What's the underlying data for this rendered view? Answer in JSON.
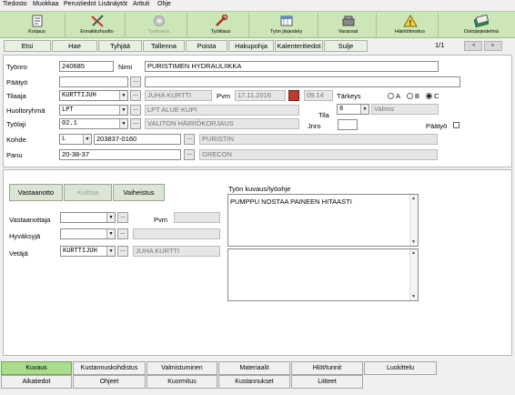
{
  "menubar": [
    "Tiedosto",
    "Muokkaa",
    "Perustiedot",
    "Lisänäytöt",
    "Arttuti",
    "Ohje"
  ],
  "toolbar": [
    {
      "label": "Korjaus",
      "icon": "document-icon",
      "enabled": true
    },
    {
      "label": "Ennakkohuolto",
      "icon": "tools-icon",
      "enabled": true
    },
    {
      "label": "Tyobonus",
      "icon": "gear-icon",
      "enabled": false
    },
    {
      "label": "Työtilaus",
      "icon": "wrench-icon",
      "enabled": true
    },
    {
      "label": "Työn järjestely",
      "icon": "schedule-icon",
      "enabled": true
    },
    {
      "label": "Varaosat",
      "icon": "parts-icon",
      "enabled": true
    },
    {
      "label": "Häiriöilmoitus",
      "icon": "warning-icon",
      "enabled": true
    },
    {
      "label": "Ostojärjestelmä",
      "icon": "purchase-icon",
      "enabled": true
    }
  ],
  "commands": [
    "Etsi",
    "Hae",
    "Tyhjää",
    "Tallenna",
    "Poista",
    "Hakupohja",
    "Kalenteritiedot",
    "Sulje"
  ],
  "pager": "1/1",
  "nav": {
    "prev": "◄",
    "next": "►"
  },
  "form": {
    "tyonro_label": "Työnro",
    "tyonro": "240685",
    "nimi_label": "Nimi",
    "nimi": "PURISTIMEN HYDRAULIIKKA",
    "paatyo_label": "Päätyö",
    "paatyo": "",
    "paatyo_desc": "",
    "tilaaja_label": "Tilaaja",
    "tilaaja": "KURTTIJUH",
    "tilaaja_name": "JUHA KURTTI",
    "pvm_label": "Pvm",
    "pvm": "17.11.2016",
    "time": "09.14",
    "tarkeys_label": "Tärkeys",
    "priorities": [
      "A",
      "B",
      "C"
    ],
    "priority_selected": "C",
    "huoltoryhma_label": "Huoltoryhmä",
    "huoltoryhma": "LPT",
    "huoltoryhma_name": "LPT ALUE KUPI",
    "tila_label": "Tila",
    "tila": "8",
    "tila_name": "Valmis",
    "tyolaji_label": "Työlaji",
    "tyolaji": "02.1",
    "tyolaji_name": "VALITON HÄIRIÖKORJAUS",
    "jnro_label": "Jnro",
    "jnro": "",
    "paatyo_chk_label": "Päätyö",
    "kohde_label": "Kohde",
    "kohde_type": "L",
    "kohde": "203837-0160",
    "kohde_name": "PURISTIN",
    "panu_label": "Panu",
    "panu": "20-38-37",
    "panu_name": "GRECON"
  },
  "section2": {
    "buttons": {
      "vastaanotto": "Vastaanotto",
      "kuittaus": "Kuittaa",
      "vaiheistus": "Vaiheistus"
    },
    "vastaanottaja_label": "Vastaanottaja",
    "vastaanottaja": "",
    "pvm_label": "Pvm",
    "pvm": "",
    "hyvaksyja_label": "Hyväksyjä",
    "hyvaksyja": "",
    "vetaja_label": "Vetäjä",
    "vetaja": "KURTTIJUH",
    "vetaja_name": "JUHA KURTTI",
    "description_label": "Työn kuvaus/työohje",
    "description": "PUMPPU NOSTAA PAINEEN HITAASTI",
    "notes": ""
  },
  "tabs": {
    "row1": [
      "Kuvaus",
      "Kustannuskohdistus",
      "Valmistuminen",
      "Materiaalit",
      "Hlöt/tunnit",
      "Luokittelu"
    ],
    "row2": [
      "Aikatiedot",
      "Ohjeet",
      "Kuormitus",
      "Kustannukset",
      "Liitteet"
    ],
    "active": "Kuvaus"
  },
  "colors": {
    "toolbar": "#cde6b8",
    "active_tab": "#a9dc8c"
  }
}
